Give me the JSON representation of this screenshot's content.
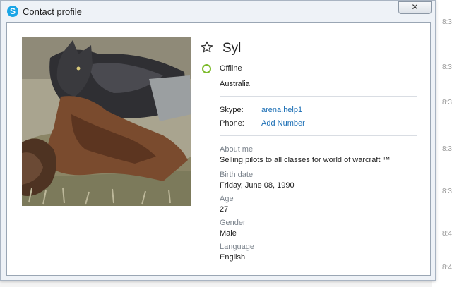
{
  "window": {
    "title": "Contact profile",
    "close_label": "✕"
  },
  "background_times": [
    "8:3",
    "8:3",
    "8:3",
    "8:3",
    "8:3",
    "8:4",
    "8:4"
  ],
  "profile": {
    "name": "Syl",
    "status": "Offline",
    "location": "Australia",
    "skype_label": "Skype:",
    "skype_value": "arena.help1",
    "phone_label": "Phone:",
    "phone_value": "Add Number",
    "about_label": "About me",
    "about_value": "Selling pilots to all classes for world of warcraft ™",
    "birth_label": "Birth date",
    "birth_value": "Friday, June 08, 1990",
    "age_label": "Age",
    "age_value": "27",
    "gender_label": "Gender",
    "gender_value": "Male",
    "language_label": "Language",
    "language_value": "English"
  },
  "colors": {
    "link": "#1c6fb5",
    "status_offline": "#7dbb2c",
    "skype_brand": "#1aa5e6"
  }
}
